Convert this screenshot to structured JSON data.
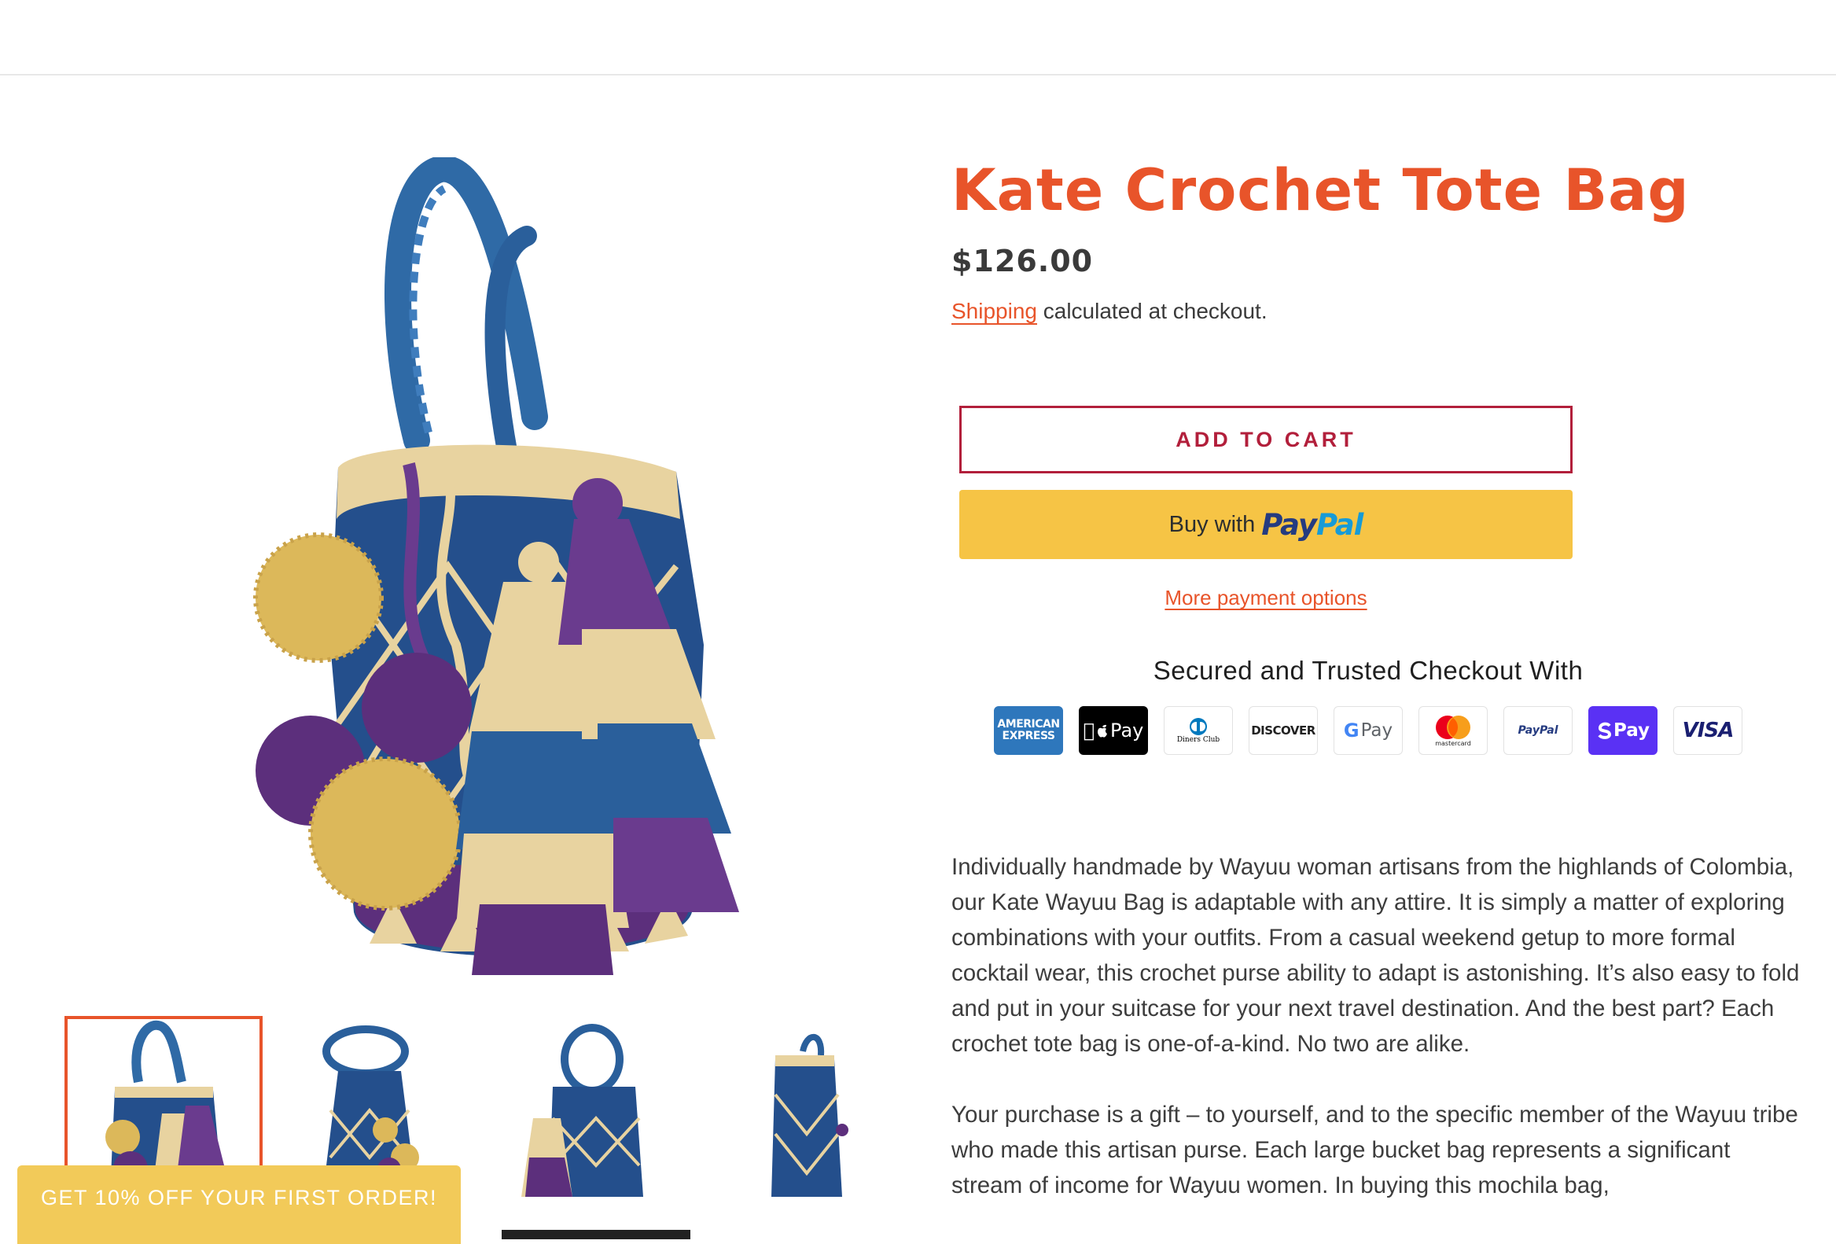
{
  "product": {
    "title": "Kate Crochet Tote Bag",
    "price": "$126.00",
    "shipping_link": "Shipping",
    "shipping_note": " calculated at checkout."
  },
  "buttons": {
    "add_to_cart": "ADD TO CART",
    "paypal_prefix": "Buy with",
    "paypal_brand_1": "Pay",
    "paypal_brand_2": "Pal",
    "more_payment_options": "More payment options"
  },
  "checkout": {
    "heading": "Secured and Trusted Checkout With",
    "methods": [
      {
        "name": "american-express-icon",
        "line1": "AMERICAN",
        "line2": "EXPRESS"
      },
      {
        "name": "apple-pay-icon",
        "label": "Pay"
      },
      {
        "name": "diners-club-icon",
        "label": "Diners Club"
      },
      {
        "name": "discover-icon",
        "label": "DISCOVER"
      },
      {
        "name": "google-pay-icon",
        "label": "Pay"
      },
      {
        "name": "mastercard-icon",
        "label": "mastercard"
      },
      {
        "name": "paypal-icon",
        "label": "PayPal"
      },
      {
        "name": "shop-pay-icon",
        "label": "Pay"
      },
      {
        "name": "visa-icon",
        "label": "VISA"
      }
    ]
  },
  "description": {
    "paragraph_1": "Individually handmade by Wayuu woman artisans from the highlands of Colombia, our Kate Wayuu Bag is adaptable with any attire. It is simply a matter of exploring combinations with your outfits.  From a casual weekend getup to more formal cocktail wear, this crochet purse ability to adapt is astonishing.  It’s also easy to fold and put in your suitcase for your next travel destination. And the best part?  Each crochet tote bag is one-of-a-kind. No two are alike.",
    "paragraph_2": "Your purchase is a gift – to yourself, and to the specific member of the Wayuu tribe who made this artisan purse. Each large bucket bag represents a significant stream of income for Wayuu women. In buying this mochila bag,"
  },
  "promo": {
    "label": "GET 10% OFF YOUR FIRST ORDER!"
  },
  "colors": {
    "accent": "#e8542a",
    "cart_border": "#b21f3b",
    "paypal_yellow": "#f6c445",
    "promo_bg": "#f2ca59",
    "bag_blue": "#244f8c",
    "bag_tan": "#e8d3a0",
    "bag_purple": "#5c2f7c",
    "pompom_gold": "#dcb85a"
  }
}
